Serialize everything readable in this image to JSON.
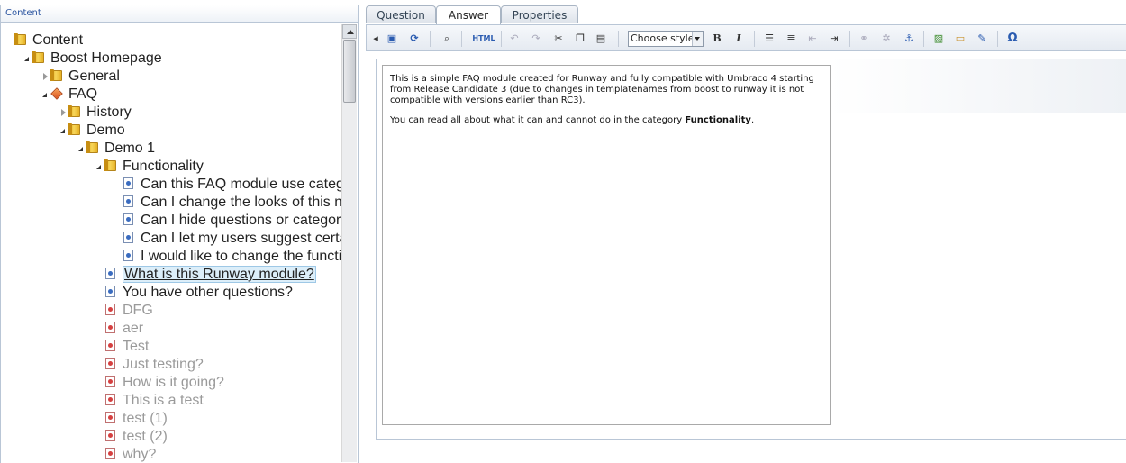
{
  "tree": {
    "header": "Content",
    "nodes": [
      {
        "label": "Content",
        "level": 0,
        "icon": "folder",
        "toggle": "none",
        "style": ""
      },
      {
        "label": "Boost Homepage",
        "level": 1,
        "icon": "folder",
        "toggle": "open",
        "style": ""
      },
      {
        "label": "General",
        "level": 2,
        "icon": "folder",
        "toggle": "closed",
        "style": ""
      },
      {
        "label": "FAQ",
        "level": 2,
        "icon": "faq",
        "toggle": "open",
        "style": ""
      },
      {
        "label": "History",
        "level": 3,
        "icon": "folder",
        "toggle": "closed",
        "style": ""
      },
      {
        "label": "Demo",
        "level": 3,
        "icon": "folder",
        "toggle": "open",
        "style": ""
      },
      {
        "label": "Demo 1",
        "level": 4,
        "icon": "folder",
        "toggle": "open",
        "style": ""
      },
      {
        "label": "Functionality",
        "level": 5,
        "icon": "folder",
        "toggle": "open",
        "style": ""
      },
      {
        "label": "Can this FAQ module use catego",
        "level": 6,
        "icon": "doc",
        "toggle": "none",
        "style": ""
      },
      {
        "label": "Can I change the looks of this mo",
        "level": 6,
        "icon": "doc",
        "toggle": "none",
        "style": ""
      },
      {
        "label": "Can I hide questions or categorie",
        "level": 6,
        "icon": "doc",
        "toggle": "none",
        "style": ""
      },
      {
        "label": "Can I let my users suggest certair",
        "level": 6,
        "icon": "doc",
        "toggle": "none",
        "style": ""
      },
      {
        "label": "I would like to change the function",
        "level": 6,
        "icon": "doc",
        "toggle": "none",
        "style": ""
      },
      {
        "label": "What is this Runway module?",
        "level": 5,
        "icon": "doc",
        "toggle": "none",
        "style": "sel"
      },
      {
        "label": "You have other questions?",
        "level": 5,
        "icon": "doc",
        "toggle": "none",
        "style": ""
      },
      {
        "label": "DFG",
        "level": 5,
        "icon": "doc-red",
        "toggle": "none",
        "style": "dim"
      },
      {
        "label": "aer",
        "level": 5,
        "icon": "doc-red",
        "toggle": "none",
        "style": "dim"
      },
      {
        "label": "Test",
        "level": 5,
        "icon": "doc-red",
        "toggle": "none",
        "style": "dim"
      },
      {
        "label": "Just testing?",
        "level": 5,
        "icon": "doc-red",
        "toggle": "none",
        "style": "dim"
      },
      {
        "label": "How is it going?",
        "level": 5,
        "icon": "doc-red",
        "toggle": "none",
        "style": "dim"
      },
      {
        "label": "This is a test",
        "level": 5,
        "icon": "doc-red",
        "toggle": "none",
        "style": "dim"
      },
      {
        "label": "test (1)",
        "level": 5,
        "icon": "doc-red",
        "toggle": "none",
        "style": "dim"
      },
      {
        "label": "test (2)",
        "level": 5,
        "icon": "doc-red",
        "toggle": "none",
        "style": "dim"
      },
      {
        "label": "why?",
        "level": 5,
        "icon": "doc-red",
        "toggle": "none",
        "style": "dim"
      },
      {
        "label": "",
        "level": 5,
        "icon": "doc-red",
        "toggle": "none",
        "style": "dim"
      }
    ]
  },
  "tabs": [
    {
      "label": "Question",
      "active": false
    },
    {
      "label": "Answer",
      "active": true
    },
    {
      "label": "Properties",
      "active": false
    }
  ],
  "toolbar": {
    "style_select": "Choose style",
    "html_label": "HTML",
    "bold_label": "B",
    "italic_label": "I",
    "omega_label": "Ω"
  },
  "answer": {
    "para1": "This is a simple FAQ module created for Runway and fully compatible with Umbraco 4 starting from Release Candidate 3 (due to changes in templatenames from boost to runway it is not compatible with versions earlier than RC3).",
    "para2_before": "You can read all about what it can and cannot do in the category ",
    "para2_bold": "Functionality",
    "para2_after": "."
  },
  "colors": {
    "accent": "#2b55a0",
    "selected_bg": "#dceef9",
    "dim_text": "#9a9a9a"
  }
}
